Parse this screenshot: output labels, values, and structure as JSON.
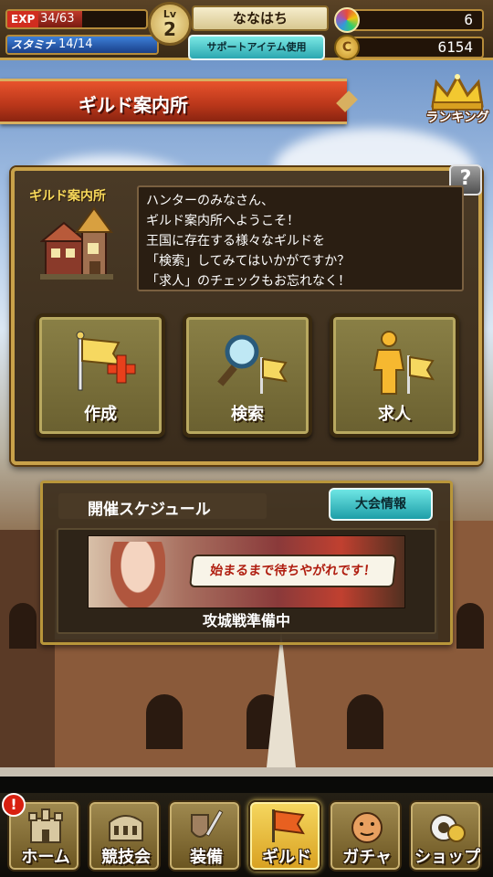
{
  "status": {
    "exp_label": "EXP",
    "exp_text": "34/63",
    "exp_progress": 0.54,
    "stamina_label": "スタミナ",
    "stamina_text": "14/14",
    "stamina_progress": 1.0,
    "level_label": "Lv",
    "level_value": "2",
    "player_name": "ななはち",
    "support_item_label": "サポートアイテム使用",
    "gems": "6",
    "coins": "6154",
    "coin_symbol": "C"
  },
  "header": {
    "title": "ギルド案内所",
    "ranking_label": "ランキング"
  },
  "guild_panel": {
    "help_label": "?",
    "npc_label": "ギルド案内所",
    "message_lines": [
      "ハンターのみなさん、",
      "ギルド案内所へようこそ！",
      "王国に存在する様々なギルドを",
      "「検索」してみてはいかがですか？",
      "「求人」のチェックもお忘れなく！"
    ],
    "actions": [
      {
        "label": "作成",
        "icon": "flag-plus-icon"
      },
      {
        "label": "検索",
        "icon": "magnifier-flag-icon"
      },
      {
        "label": "求人",
        "icon": "person-flag-icon"
      }
    ]
  },
  "schedule": {
    "title": "開催スケジュール",
    "tournament_button": "大会情報",
    "banner_text": "始まるまで待ちやがれです！",
    "status_text": "攻城戦準備中"
  },
  "nav": {
    "notification": "!",
    "items": [
      {
        "label": "ホーム",
        "icon": "castle-icon",
        "active": false
      },
      {
        "label": "競技会",
        "icon": "colosseum-icon",
        "active": false
      },
      {
        "label": "装備",
        "icon": "sword-shield-icon",
        "active": false
      },
      {
        "label": "ギルド",
        "icon": "flag-icon",
        "active": true
      },
      {
        "label": "ガチャ",
        "icon": "gacha-egg-icon",
        "active": false
      },
      {
        "label": "ショップ",
        "icon": "coin-bag-icon",
        "active": false
      }
    ]
  },
  "colors": {
    "accent_gold": "#c9a24a",
    "title_red": "#d8452a",
    "button_cyan": "#2ba7b0",
    "active_nav": "#f6d860"
  }
}
